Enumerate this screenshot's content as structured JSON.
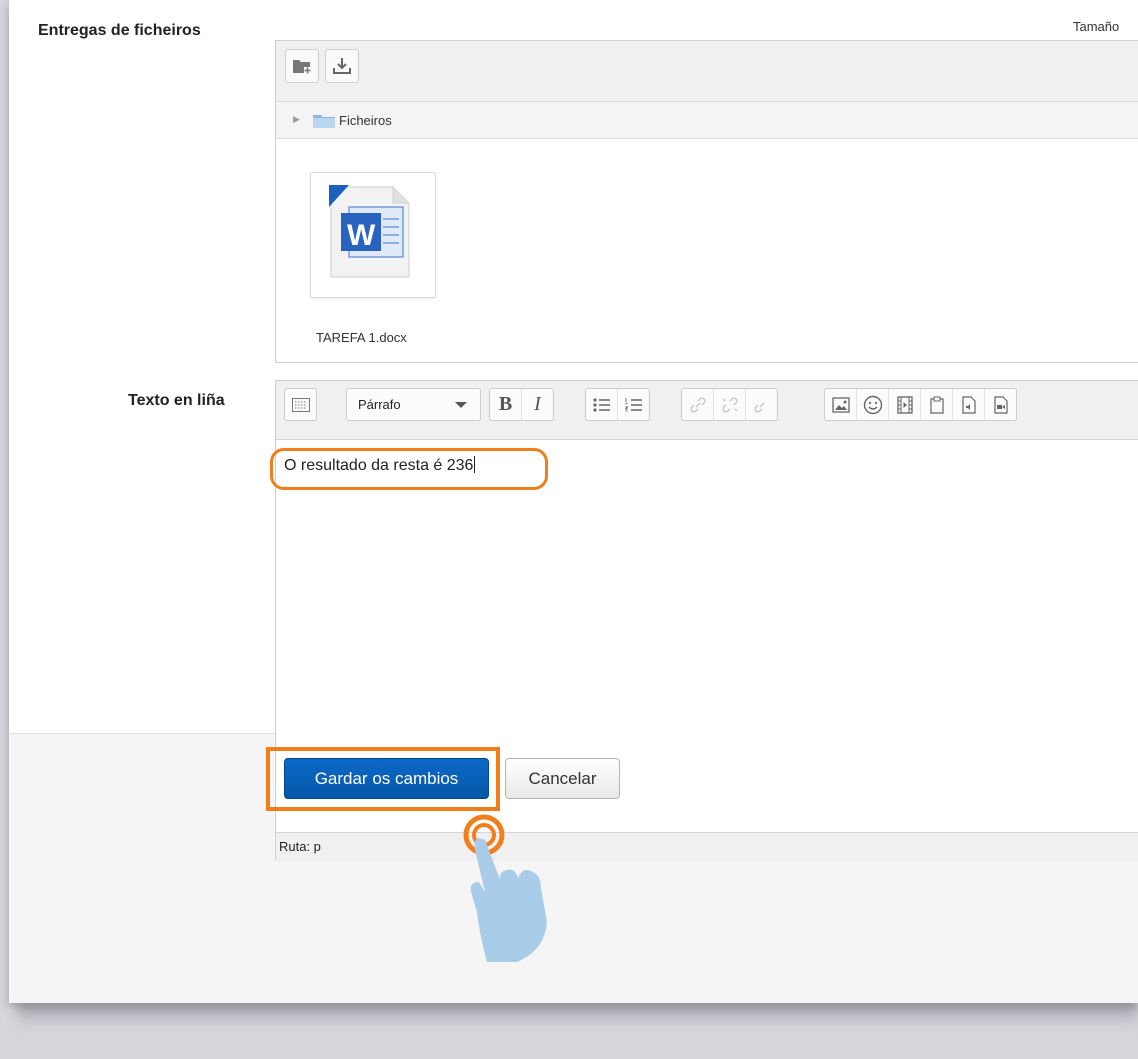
{
  "form": {
    "file_submissions_label": "Entregas de ficheiros",
    "size_header": "Tamaño",
    "file_manager": {
      "add_icon": "folder-add-icon",
      "download_icon": "download-icon",
      "path_label": "Ficheiros",
      "files": [
        {
          "name": "TAREFA 1.docx",
          "icon": "word-document-icon"
        }
      ]
    },
    "online_text_label": "Texto en liña",
    "editor": {
      "format_select": "Párrafo",
      "toolbar_icons": [
        "toolbar-toggle-icon",
        "bold-icon",
        "italic-icon",
        "unordered-list-icon",
        "ordered-list-icon",
        "link-icon",
        "unlink-icon",
        "anchor-icon",
        "image-icon",
        "emoticon-icon",
        "media-icon",
        "paste-icon",
        "record-audio-icon",
        "record-video-icon"
      ],
      "bold_glyph": "B",
      "italic_glyph": "I",
      "content": "O resultado da resta é 236",
      "status_path": "Ruta: p"
    }
  },
  "actions": {
    "save_label": "Gardar os cambios",
    "cancel_label": "Cancelar"
  },
  "colors": {
    "highlight": "#f07e1b",
    "primary": "#0b62b8",
    "pointer": "#a9cde9"
  }
}
